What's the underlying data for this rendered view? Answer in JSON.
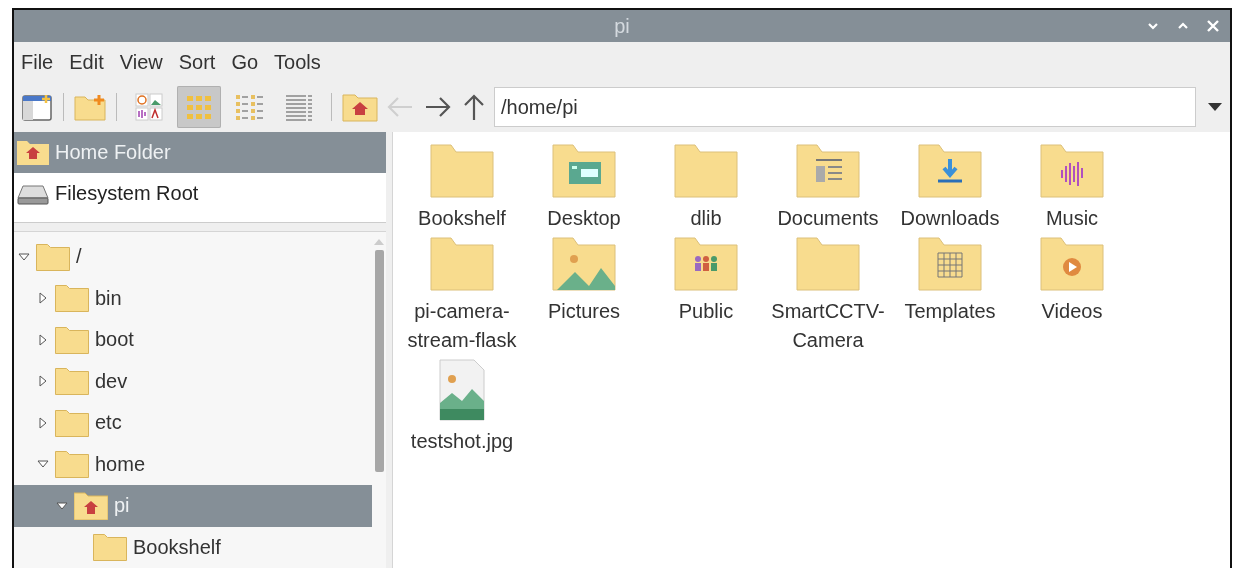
{
  "window": {
    "title": "pi"
  },
  "menu": [
    "File",
    "Edit",
    "View",
    "Sort",
    "Go",
    "Tools"
  ],
  "toolbar": {
    "view_modes": [
      {
        "kind": "thumbnail",
        "selected": false
      },
      {
        "kind": "icons",
        "selected": true
      },
      {
        "kind": "compact",
        "selected": false
      },
      {
        "kind": "list",
        "selected": false
      }
    ],
    "back_disabled": true,
    "forward_disabled": false,
    "path": "/home/pi"
  },
  "places": [
    {
      "label": "Home Folder",
      "kind": "home",
      "selected": true
    },
    {
      "label": "Filesystem Root",
      "kind": "drive",
      "selected": false
    }
  ],
  "tree": [
    {
      "label": "/",
      "kind": "folder",
      "expanded": true,
      "selected": false,
      "children": [
        {
          "label": "bin",
          "kind": "folder",
          "expanded": false,
          "selected": false
        },
        {
          "label": "boot",
          "kind": "folder",
          "expanded": false,
          "selected": false
        },
        {
          "label": "dev",
          "kind": "folder",
          "expanded": false,
          "selected": false
        },
        {
          "label": "etc",
          "kind": "folder",
          "expanded": false,
          "selected": false
        },
        {
          "label": "home",
          "kind": "folder",
          "expanded": true,
          "selected": false,
          "children": [
            {
              "label": "pi",
              "kind": "home",
              "expanded": true,
              "selected": true,
              "children": [
                {
                  "label": "Bookshelf",
                  "kind": "folder",
                  "selected": false
                }
              ]
            }
          ]
        }
      ]
    }
  ],
  "files": [
    {
      "name": "Bookshelf",
      "kind": "folder"
    },
    {
      "name": "Desktop",
      "kind": "desktop"
    },
    {
      "name": "dlib",
      "kind": "folder"
    },
    {
      "name": "Documents",
      "kind": "documents"
    },
    {
      "name": "Downloads",
      "kind": "downloads"
    },
    {
      "name": "Music",
      "kind": "music"
    },
    {
      "name": "pi-camera-stream-flask",
      "kind": "folder"
    },
    {
      "name": "Pictures",
      "kind": "pictures"
    },
    {
      "name": "Public",
      "kind": "public"
    },
    {
      "name": "SmartCCTV-Camera",
      "kind": "folder"
    },
    {
      "name": "Templates",
      "kind": "templates"
    },
    {
      "name": "Videos",
      "kind": "videos"
    },
    {
      "name": "testshot.jpg",
      "kind": "image"
    }
  ]
}
